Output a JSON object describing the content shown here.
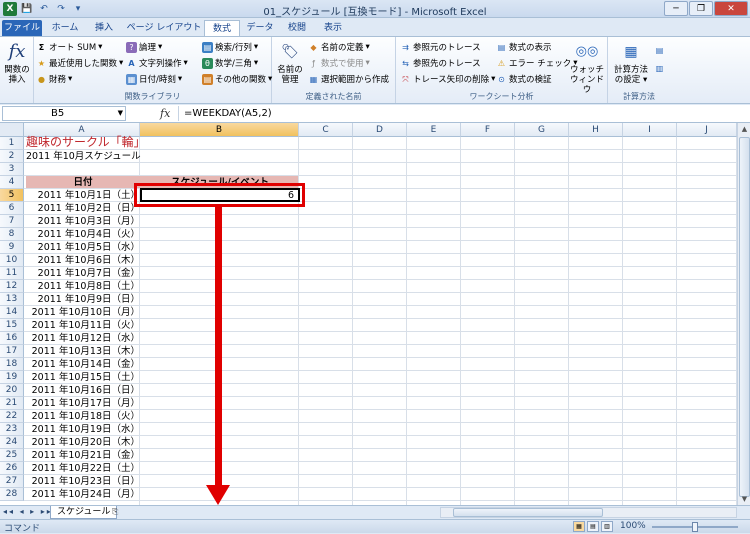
{
  "window": {
    "title": "01_スケジュール [互換モード] - Microsoft Excel",
    "minimize": "─",
    "restore": "❐",
    "close": "✕"
  },
  "qat": [
    "X",
    "💾",
    "↶",
    "↷",
    "▾"
  ],
  "tabs": [
    "ファイル",
    "ホーム",
    "挿入",
    "ページ レイアウト",
    "数式",
    "データ",
    "校閲",
    "表示"
  ],
  "active_tab": "数式",
  "ribbon": {
    "insert_function": {
      "icon": "fx",
      "label1": "関数の",
      "label2": "挿入"
    },
    "library": {
      "label": "関数ライブラリ",
      "autosum": "オート SUM",
      "recent": "最近使用した関数",
      "financial": "財務",
      "logical": "論理",
      "text": "文字列操作",
      "datetime": "日付/時刻",
      "lookup": "検索/行列",
      "math": "数学/三角",
      "more": "その他の関数"
    },
    "names": {
      "label": "定義された名前",
      "manager1": "名前の",
      "manager2": "管理",
      "define": "名前の定義",
      "use": "数式で使用",
      "create": "選択範囲から作成"
    },
    "audit": {
      "label": "ワークシート分析",
      "precedents": "参照元のトレース",
      "dependents": "参照先のトレース",
      "remove": "トレース矢印の削除",
      "show": "数式の表示",
      "error": "エラー チェック",
      "evaluate": "数式の検証",
      "watch1": "ウォッチ",
      "watch2": "ウィンドウ"
    },
    "calc": {
      "label": "計算方法",
      "options1": "計算方法",
      "options2": "の設定"
    }
  },
  "formula_bar": {
    "name_box": "B5",
    "fx": "fx",
    "formula": "=WEEKDAY(A5,2)"
  },
  "columns": [
    "A",
    "B",
    "C",
    "D",
    "E",
    "F",
    "G",
    "H",
    "I",
    "J"
  ],
  "rows": [
    "1",
    "2",
    "3",
    "4",
    "5",
    "6",
    "7",
    "8",
    "9",
    "10",
    "11",
    "12",
    "13",
    "14",
    "15",
    "16",
    "17",
    "18",
    "19",
    "20",
    "21",
    "22",
    "23",
    "24",
    "25",
    "26",
    "27",
    "28"
  ],
  "sheet": {
    "a1": "趣味のサークル「輪」",
    "a2": "2011 年10月スケジュール",
    "a4": "日付",
    "b4": "スケジュール/イベント",
    "b5": "6",
    "dates": [
      "2011 年10月1日（土）",
      "2011 年10月2日（日）",
      "2011 年10月3日（月）",
      "2011 年10月4日（火）",
      "2011 年10月5日（水）",
      "2011 年10月6日（木）",
      "2011 年10月7日（金）",
      "2011 年10月8日（土）",
      "2011 年10月9日（日）",
      "2011 年10月10日（月）",
      "2011 年10月11日（火）",
      "2011 年10月12日（水）",
      "2011 年10月13日（木）",
      "2011 年10月14日（金）",
      "2011 年10月15日（土）",
      "2011 年10月16日（日）",
      "2011 年10月17日（月）",
      "2011 年10月18日（火）",
      "2011 年10月19日（水）",
      "2011 年10月20日（木）",
      "2011 年10月21日（金）",
      "2011 年10月22日（土）",
      "2011 年10月23日（日）",
      "2011 年10月24日（月）"
    ]
  },
  "sheet_tabs": {
    "nav": "◂◂ ◂ ▸ ▸▸",
    "active": "スケジュール",
    "new": "⎘"
  },
  "status": {
    "mode": "コマンド",
    "zoom": "100%"
  },
  "colors": {
    "title_red": "#c0272d",
    "header_band": "#e6b7b3",
    "annotation_red": "#e00000"
  }
}
